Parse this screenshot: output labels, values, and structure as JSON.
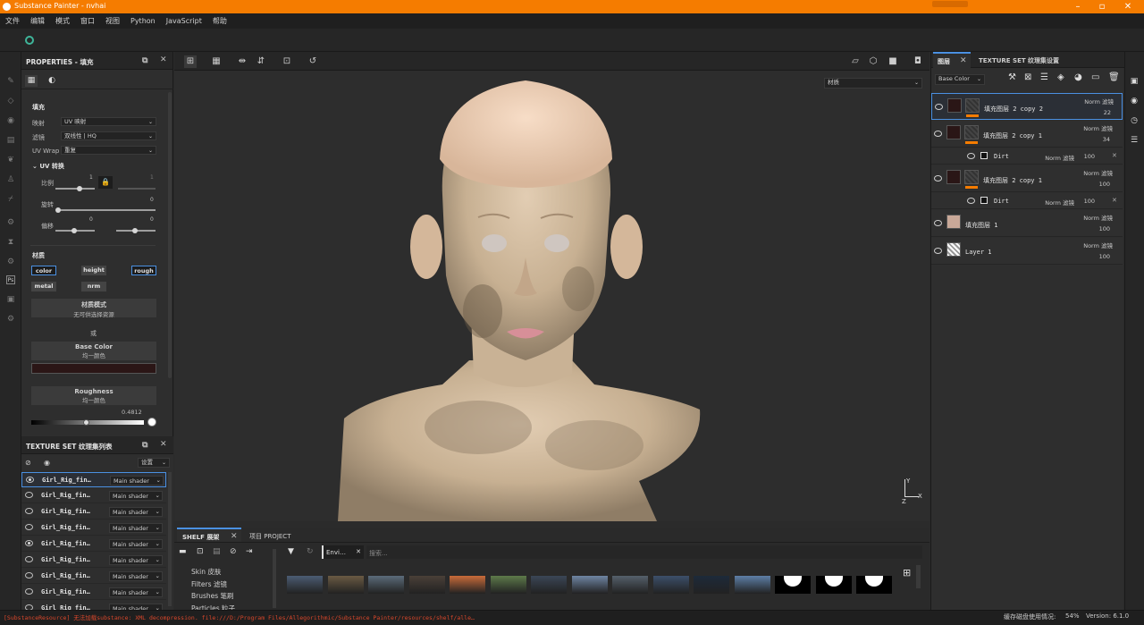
{
  "titlebar": {
    "title": "Substance Painter - nvhai"
  },
  "menu": [
    "文件",
    "编辑",
    "模式",
    "窗口",
    "视图",
    "Python",
    "JavaScript",
    "帮助"
  ],
  "properties": {
    "title": "PROPERTIES - 填充",
    "fill_title": "填充",
    "mapping_label": "映射",
    "mapping_value": "UV 映射",
    "filter_label": "滤镜",
    "filter_value": "双线性 | HQ",
    "uvwrap_label": "UV Wrap",
    "uvwrap_value": "重复",
    "uv_transform": "UV 转换",
    "scale_label": "比例",
    "scale_value": "1",
    "scale_value2": "1",
    "rotate_label": "旋转",
    "rotate_value": "0",
    "offset_label": "偏移",
    "offset_value1": "0",
    "offset_value2": "0",
    "material_title": "材质",
    "channels": [
      "color",
      "height",
      "rough",
      "metal",
      "nrm"
    ],
    "material_mode_title": "材质模式",
    "material_mode_sub": "无可供选择资源",
    "or": "或",
    "basecolor_title": "Base Color",
    "basecolor_sub": "均一颜色",
    "basecolor_swatch": "#2b1616",
    "roughness_title": "Roughness",
    "roughness_sub": "均一颜色",
    "roughness_value": "0.4812",
    "roughness_fraction": 0.4812
  },
  "texture_sets": {
    "title": "TEXTURE SET 纹理集列表",
    "settings": "设置",
    "rows": [
      {
        "name": "Girl_Rig_fin…",
        "shader": "Main shader",
        "visible": true
      },
      {
        "name": "Girl_Rig_fin…",
        "shader": "Main shader",
        "visible": false
      },
      {
        "name": "Girl_Rig_fin…",
        "shader": "Main shader",
        "visible": false
      },
      {
        "name": "Girl_Rig_fin…",
        "shader": "Main shader",
        "visible": false
      },
      {
        "name": "Girl_Rig_fin…",
        "shader": "Main shader",
        "visible": true
      },
      {
        "name": "Girl_Rig_fin…",
        "shader": "Main shader",
        "visible": false
      },
      {
        "name": "Girl_Rig_fin…",
        "shader": "Main shader",
        "visible": false
      },
      {
        "name": "Girl_Rig_fin…",
        "shader": "Main shader",
        "visible": false
      },
      {
        "name": "Girl_Rig_fin…",
        "shader": "Main shader",
        "visible": false
      }
    ]
  },
  "viewport": {
    "material_dropdown": "材质",
    "axis_x": "X",
    "axis_y": "Y",
    "axis_z": "Z"
  },
  "shelf": {
    "tab": "SHELF 展架",
    "project_tab": "项目 PROJECT",
    "categories": [
      "Skin 皮肤",
      "Filters 滤镜",
      "Brushes 笔刷",
      "Particles 粒子"
    ],
    "filter_tag": "Envi…",
    "search_placeholder": "搜索..."
  },
  "layers": {
    "tab": "图层",
    "tab2": "TEXTURE SET 纹理集设置",
    "channel": "Base Color",
    "items": [
      {
        "name": "填充图层 2 copy 2",
        "blend": "Norm 滤镜",
        "opacity": "22",
        "selected": true
      },
      {
        "name": "填充图层 2 copy 1",
        "blend": "Norm 滤镜",
        "opacity": "34"
      },
      {
        "name": "Dirt",
        "blend": "Norm 滤镜",
        "opacity": "100",
        "sub": true
      },
      {
        "name": "填充图层 2 copy 1",
        "blend": "Norm 滤镜",
        "opacity": "100"
      },
      {
        "name": "Dirt",
        "blend": "Norm 滤镜",
        "opacity": "100",
        "sub": true
      },
      {
        "name": "填充图层 1",
        "blend": "Norm 滤镜",
        "opacity": "100"
      },
      {
        "name": "Layer 1",
        "blend": "Norm 滤镜",
        "opacity": "100"
      }
    ]
  },
  "status": {
    "left": "[SubstanceResource] 无法加载substance: XML decompression. file:///D:/Program Files/Allegorithmic/Substance Painter/resources/shelf/alle…",
    "cache": "缓存磁盘使用情况:",
    "cache_value": "54%",
    "version": "Version: 6.1.0"
  },
  "colors": {
    "accent": "#f57c00",
    "select": "#4a90e2"
  }
}
